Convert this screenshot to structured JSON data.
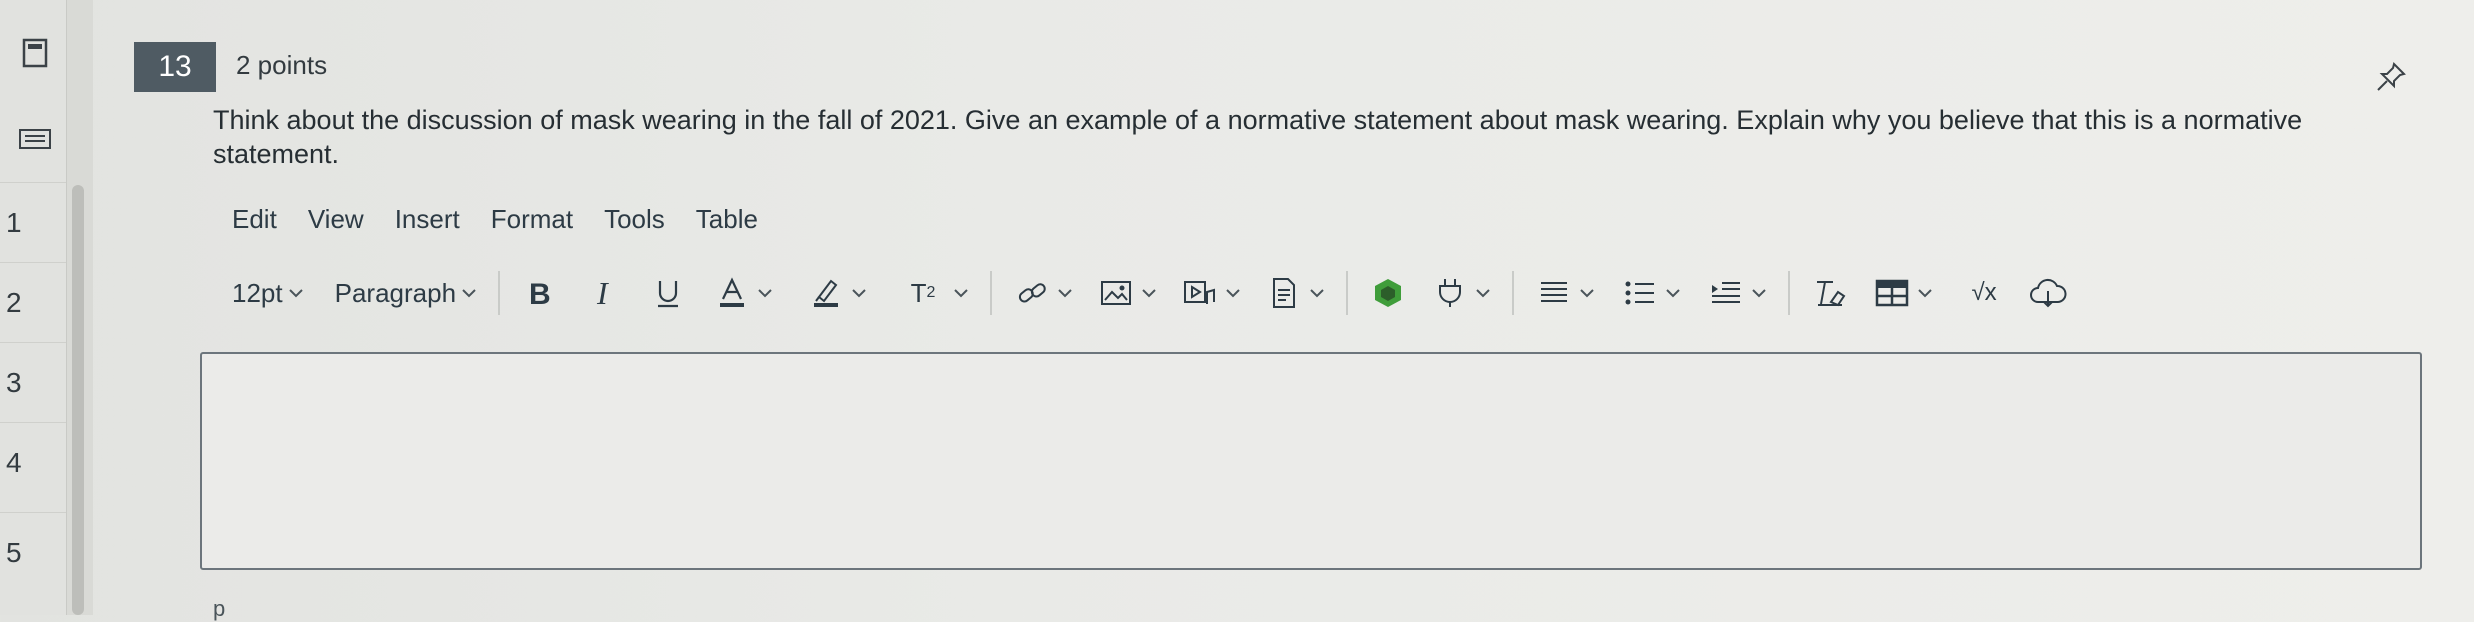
{
  "nav": {
    "numbers": [
      "1",
      "2",
      "3",
      "4",
      "5"
    ],
    "icons": [
      "calculator-icon",
      "keyboard-icon"
    ]
  },
  "question": {
    "number": "13",
    "points": "2 points",
    "text": "Think about the discussion of mask wearing in the fall of 2021. Give an example of a normative statement about mask wearing. Explain why you believe that this is a normative statement.",
    "pin_icon": "pin-icon"
  },
  "editor": {
    "menu": [
      "Edit",
      "View",
      "Insert",
      "Format",
      "Tools",
      "Table"
    ],
    "font_size": "12pt",
    "block_format": "Paragraph",
    "superscript_label": "T",
    "superscript_sup": "2",
    "math_label": "√x",
    "status_path": "p",
    "icons": [
      "bold-icon",
      "italic-icon",
      "underline-icon",
      "text-color-icon",
      "highlight-icon",
      "superscript-icon",
      "link-icon",
      "image-icon",
      "media-icon",
      "document-icon",
      "apps-icon",
      "plug-icon",
      "align-icon",
      "bullet-list-icon",
      "indent-icon",
      "clear-format-icon",
      "table-icon",
      "math-icon",
      "cloud-icon"
    ]
  },
  "colors": {
    "question_badge": "#4f5b63",
    "text_primary": "#2d3b45",
    "apps_green": "#3f9d3a",
    "border": "#6c757c"
  }
}
